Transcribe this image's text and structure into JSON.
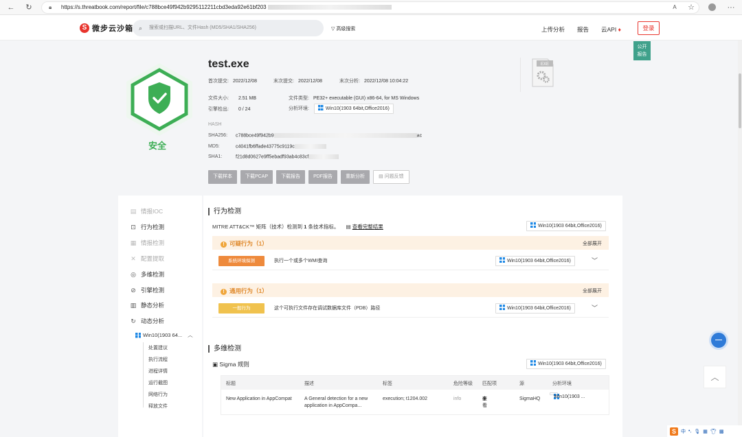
{
  "browser": {
    "url_prefix": "https://s.threatbook.com/report/file/c788bce49f942b9295112211cbd3eda92e61bf203"
  },
  "topnav": {
    "logo_text": "微步云沙箱",
    "search_placeholder": "搜索或扫描URL、文件Hash (MD5/SHA1/SHA256)",
    "advanced_search": "高级搜索",
    "upload": "上传分析",
    "report": "报告",
    "cloud_api": "云API",
    "login": "登录"
  },
  "public_report": {
    "line1": "公开",
    "line2": "报告"
  },
  "file": {
    "verdict": "安全",
    "name": "test.exe",
    "first_submit_label": "首次提交:",
    "first_submit": "2022/12/08",
    "last_submit_label": "末次提交:",
    "last_submit": "2022/12/08",
    "last_analysis_label": "末次分析:",
    "last_analysis": "2022/12/08 10:04:22",
    "size_label": "文件大小:",
    "size": "2.51 MB",
    "type_label": "文件类型:",
    "type": "PE32+ executable (GUI) x86-64, for MS Windows",
    "engine_label": "引擎检出:",
    "engine": "0 / 24",
    "env_label": "分析环境:",
    "env": "Win10(1903 64bit,Office2016)",
    "hash_label": "HASH",
    "sha256_label": "SHA256:",
    "sha256": "c788bce49f942b9",
    "sha256_tail": "ac",
    "md5_label": "MD5:",
    "md5": "c4041fb6ffade43775c9119c",
    "sha1_label": "SHA1:",
    "sha1": "f21d8d0627e9ff5ebadf93ab4c83cf",
    "exe_icon_text": "EXE"
  },
  "buttons": {
    "download_sample": "下载样本",
    "download_pcap": "下载PCAP",
    "download_report": "下载报告",
    "pdf_report": "PDF报告",
    "reanalyze": "重新分析",
    "feedback": "问题反馈"
  },
  "sidebar": {
    "items": [
      {
        "label": "情报IOC",
        "icon": "ioc-icon"
      },
      {
        "label": "行为检测",
        "icon": "behavior-icon"
      },
      {
        "label": "情报检测",
        "icon": "intel-icon"
      },
      {
        "label": "配置提取",
        "icon": "config-icon"
      },
      {
        "label": "多维检测",
        "icon": "multi-icon"
      },
      {
        "label": "引擎检测",
        "icon": "engine-icon"
      },
      {
        "label": "静态分析",
        "icon": "static-icon"
      },
      {
        "label": "动态分析",
        "icon": "dynamic-icon"
      }
    ],
    "env_item": "Win10(1903 64...",
    "sub_items": [
      "处置建议",
      "执行流程",
      "进程详情",
      "运行截图",
      "网络行为",
      "释放文件"
    ]
  },
  "behavior": {
    "title": "行为检测",
    "mitre_prefix": "MITRE ATT&CK™ 矩阵（技术）检测到",
    "mitre_count": "1",
    "mitre_suffix": "条技术指标。",
    "view_full": "查看完整结果",
    "env": "Win10(1903 64bit,Office2016)",
    "groups": [
      {
        "title": "可疑行为（1）",
        "expand": "全部展开",
        "tag": "系统环境探测",
        "tag_color": "#ee8a3c",
        "desc": "执行一个或多个WMI查询",
        "env": "Win10(1903 64bit,Office2016)"
      },
      {
        "title": "通用行为（1）",
        "expand": "全部展开",
        "tag": "一般行为",
        "tag_color": "#f0c24e",
        "desc": "这个可执行文件存在调试数据库文件（PDB）路径",
        "env": "Win10(1903 64bit,Office2016)"
      }
    ]
  },
  "multi": {
    "title": "多维检测",
    "sigma_label": "Sigma 规则",
    "env": "Win10(1903 64bit,Office2016)",
    "headers": [
      "标题",
      "描述",
      "标签",
      "危险等级",
      "匹配项",
      "源",
      "分析环境"
    ],
    "row": {
      "title": "New Application in AppCompat",
      "desc": "A General detection for a new application in AppCompa...",
      "tags": "execution; t1204.002",
      "level": "info",
      "match": "查看",
      "source": "SigmaHQ",
      "env": "Win10(1903 ..."
    }
  }
}
